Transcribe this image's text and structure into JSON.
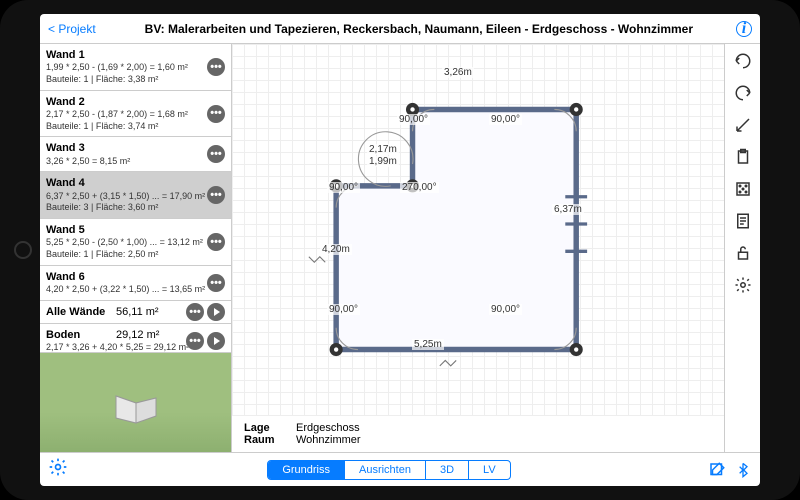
{
  "header": {
    "back": "< Projekt",
    "title": "BV: Malerarbeiten und Tapezieren, Reckersbach, Naumann, Eileen - Erdgeschoss - Wohnzimmer"
  },
  "walls": [
    {
      "name": "Wand 1",
      "calc": "1,99 * 2,50  - (1,69 * 2,00)  = 1,60 m²",
      "parts": "Bauteile: 1 | Fläche: 3,38 m²",
      "selected": false
    },
    {
      "name": "Wand 2",
      "calc": "2,17 * 2,50  - (1,87 * 2,00)  = 1,68 m²",
      "parts": "Bauteile: 1 | Fläche: 3,74 m²",
      "selected": false
    },
    {
      "name": "Wand 3",
      "calc": "3,26 * 2,50  = 8,15 m²",
      "parts": "",
      "selected": false
    },
    {
      "name": "Wand 4",
      "calc": "6,37 * 2,50  + (3,15 * 1,50) ... = 17,90 m²",
      "parts": "Bauteile: 3 | Fläche: 3,60 m²",
      "selected": true
    },
    {
      "name": "Wand 5",
      "calc": "5,25 * 2,50  - (2,50 * 1,00) ... = 13,12 m²",
      "parts": "Bauteile: 1 | Fläche: 2,50 m²",
      "selected": false
    },
    {
      "name": "Wand 6",
      "calc": "4,20 * 2,50  + (3,22 * 1,50) ... = 13,65 m²",
      "parts": "",
      "selected": false
    }
  ],
  "summary": {
    "all_walls_label": "Alle Wände",
    "all_walls_val": "56,11 m²",
    "floor_label": "Boden",
    "floor_val": "29,12 m²",
    "floor_calc": "2,17 * 3,26  + 4,20 * 5,25  = 29,12 m²"
  },
  "plan": {
    "dims": {
      "top": "3,26m",
      "right": "6,37m",
      "bottom": "5,25m",
      "left": "4,20m",
      "notch_w": "2,17m",
      "notch_h": "1,99m"
    },
    "angles": {
      "tl": "90,00°",
      "tr": "90,00°",
      "inner": "270,00°",
      "ml": "90,00°",
      "bl": "90,00°",
      "br": "90,00°"
    },
    "meta": {
      "lage_label": "Lage",
      "lage_val": "Erdgeschoss",
      "raum_label": "Raum",
      "raum_val": "Wohnzimmer"
    }
  },
  "tabs": [
    {
      "label": "Grundriss",
      "active": true
    },
    {
      "label": "Ausrichten",
      "active": false
    },
    {
      "label": "3D",
      "active": false
    },
    {
      "label": "LV",
      "active": false
    }
  ]
}
